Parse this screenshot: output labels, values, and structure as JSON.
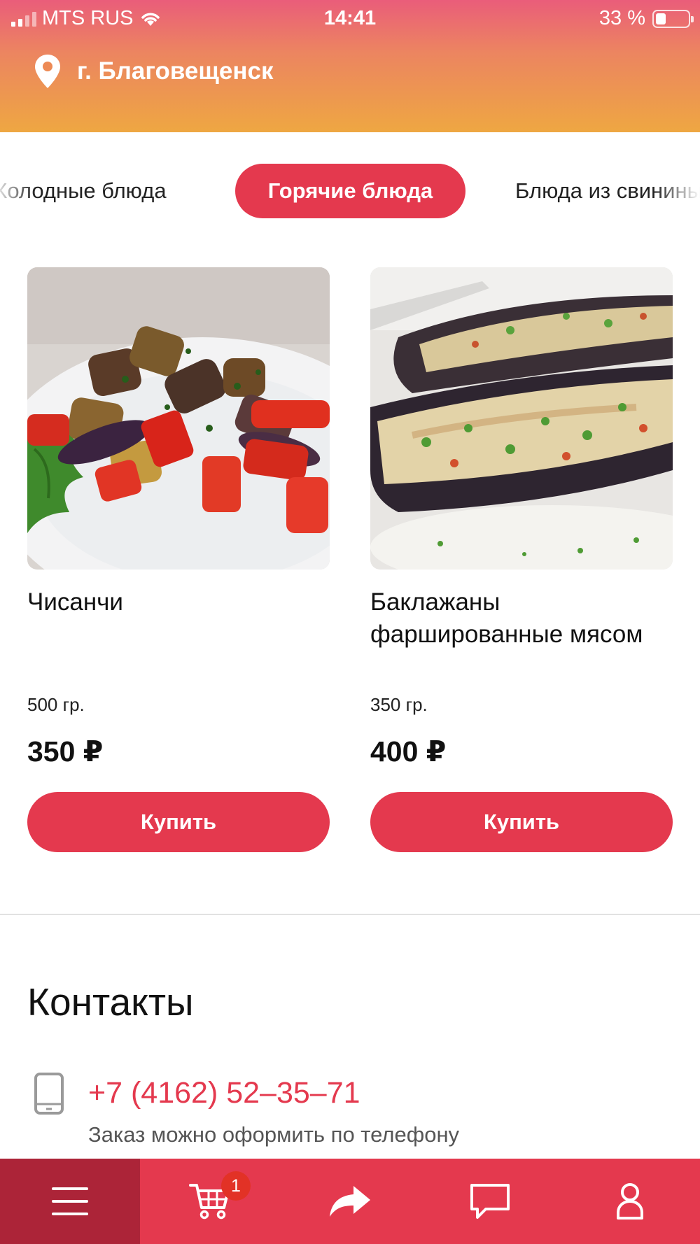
{
  "status_bar": {
    "carrier": "MTS RUS",
    "time": "14:41",
    "battery": "33 %"
  },
  "header": {
    "city": "г. Благовещенск"
  },
  "categories": {
    "left": "Холодные блюда",
    "active": "Горячие блюда",
    "right": "Блюда из свинины"
  },
  "products": [
    {
      "name": "Чисанчи",
      "weight": "500 гр.",
      "price": "350 ₽",
      "buy_label": "Купить"
    },
    {
      "name": "Баклажаны фаршированные мясом",
      "weight": "350 гр.",
      "price": "400 ₽",
      "buy_label": "Купить"
    }
  ],
  "contacts": {
    "title": "Контакты",
    "phone": "+7 (4162) 52–35–71",
    "note": "Заказ можно оформить по телефону"
  },
  "bottom_nav": {
    "cart_badge": "1",
    "items": [
      "menu-icon",
      "cart-icon",
      "share-icon",
      "chat-icon",
      "profile-icon"
    ]
  },
  "colors": {
    "accent": "#e4394e",
    "accent_dark": "#ac2438",
    "header_top": "#ea5d7a",
    "header_bottom": "#eea742"
  }
}
